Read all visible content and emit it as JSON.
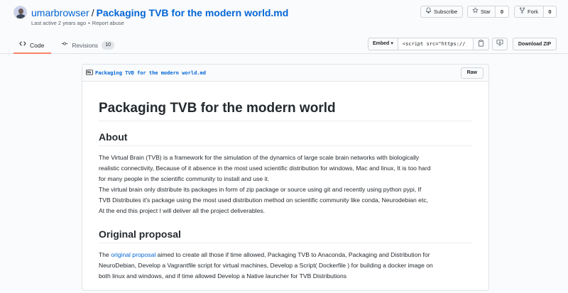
{
  "header": {
    "owner": "umarbrowser",
    "separator": "/",
    "filename": "Packaging TVB for the modern world.md",
    "last_active": "Last active 2 years ago",
    "dot": "•",
    "report": "Report abuse",
    "subscribe_label": "Subscribe",
    "star_label": "Star",
    "star_count": "0",
    "fork_label": "Fork",
    "fork_count": "0"
  },
  "tabs": [
    {
      "label": "Code",
      "icon": "code-icon",
      "active": true
    },
    {
      "label": "Revisions",
      "icon": "git-commit-icon",
      "count": "10",
      "active": false
    }
  ],
  "embed": {
    "button_label": "Embed",
    "caret": "▾",
    "value": "<script src=\"https://",
    "download_label": "Download ZIP"
  },
  "file": {
    "name": "Packaging TVB for the modern world.md",
    "raw_label": "Raw"
  },
  "markdown": {
    "h1": "Packaging TVB for the modern world",
    "about_heading": "About",
    "about_lines": [
      "The Virtual Brain (TVB) is a framework for the simulation of the dynamics of large scale brain networks with biologically",
      "realistic connectivity, Because of it absence in the most used scientific distribution for windows, Mac and linux, It is too hard",
      "for many people in the scientific community to install and use it.",
      "The virtual brain only distribute its packages in form of zip package or source using git and recently using python pypi, If",
      "TVB Distributes it's package using the most used distribution method on scientific community like conda, Neurodebian etc,",
      "At the end this project I will deliver all the project deliverables."
    ],
    "proposal_heading": "Original proposal",
    "proposal_prefix": "The ",
    "proposal_link": "original proposal",
    "proposal_first_rest": " aimed to create all those if time allowed, Packaging TVB to Anaconda, Packaging and Distribution for",
    "proposal_lines": [
      "NeuroDebian, Develop a Vagrantfile script for virtual machines, Develop a Script( Dockerfile ) for building a docker image on",
      "both linux and windows, and if time allowed Develop a Native launcher for TVB Distributions"
    ]
  },
  "colors": {
    "link": "#0366d6",
    "active_tab_underline": "#f9826c",
    "border": "#e1e4e8"
  }
}
